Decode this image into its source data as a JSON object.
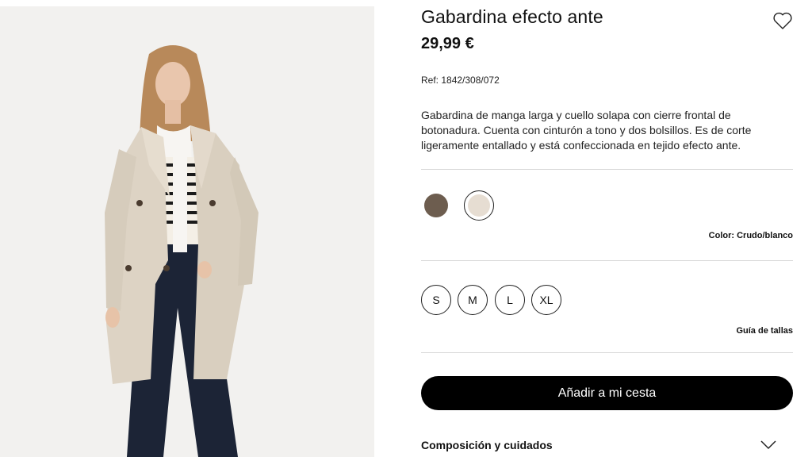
{
  "product": {
    "title": "Gabardina efecto ante",
    "price": "29,99 €",
    "ref": "Ref: 1842/308/072",
    "description": "Gabardina de manga larga y cuello solapa con cierre frontal de botonadura. Cuenta con cinturón a tono y dos bolsillos. Es de corte ligeramente entallado y está confeccionada en tejido efecto ante."
  },
  "icons": {
    "favorite": "heart-outline-icon",
    "expand": "chevron-down-icon"
  },
  "colors": {
    "options": [
      {
        "hex": "#6d5d4f",
        "selected": false
      },
      {
        "hex": "#e6ddd2",
        "selected": true
      }
    ],
    "label": "Color: Crudo/blanco"
  },
  "sizes": {
    "options": [
      "S",
      "M",
      "L",
      "XL"
    ],
    "guide_label": "Guía de tallas"
  },
  "actions": {
    "add_to_cart": "Añadir a mi cesta"
  },
  "details": {
    "composition_label": "Composición y cuidados"
  }
}
